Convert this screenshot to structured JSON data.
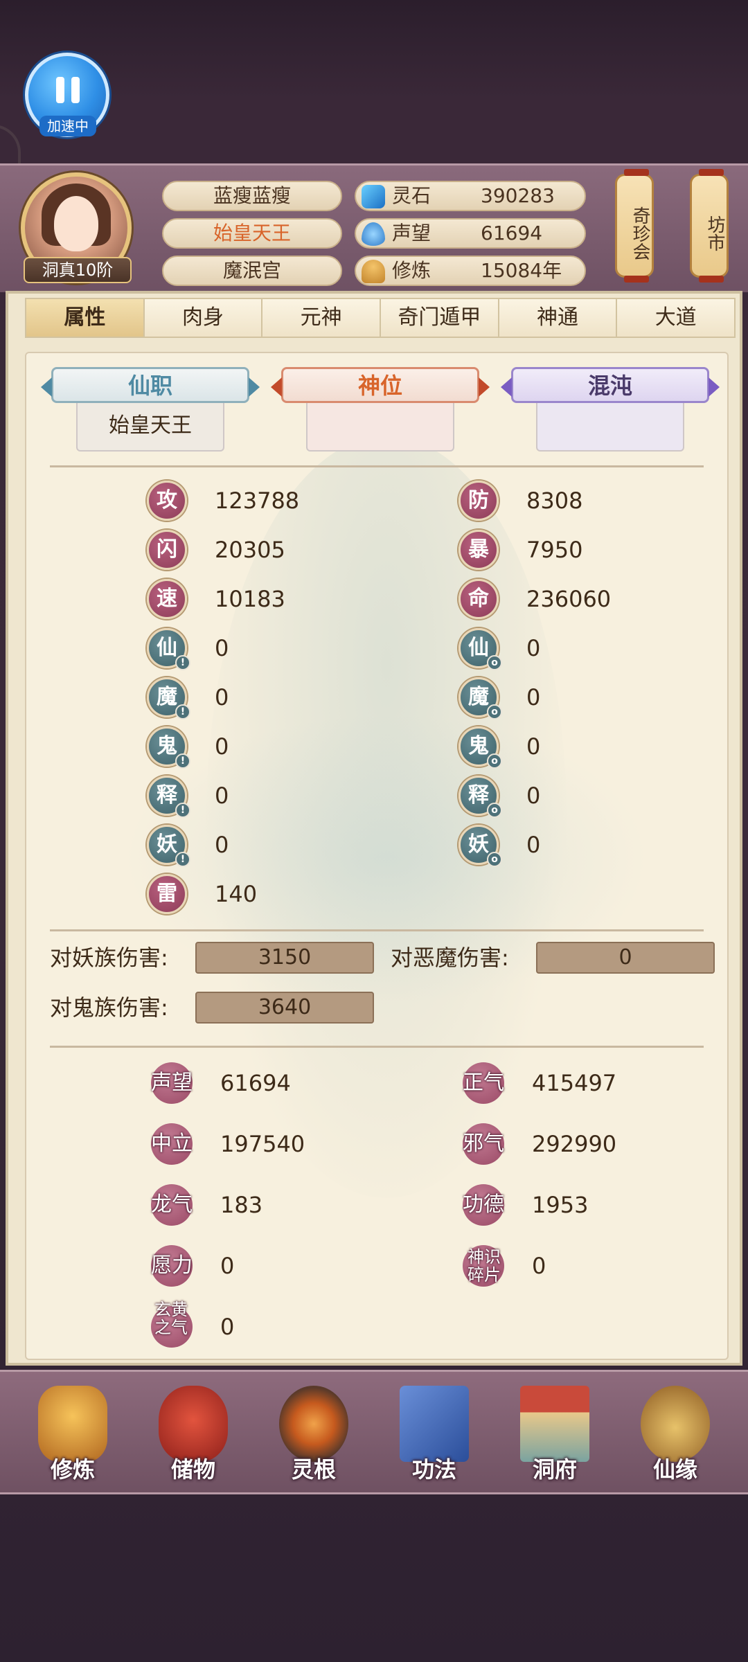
{
  "speed_button": {
    "label": "加速中"
  },
  "header": {
    "level": "洞真10阶",
    "names": [
      "蓝瘦蓝瘦",
      "始皇天王",
      "魔泯宫"
    ],
    "resources": [
      {
        "label": "灵石",
        "value": "390283",
        "icon": "spirit-stone-icon"
      },
      {
        "label": "声望",
        "value": "61694",
        "icon": "reputation-icon"
      },
      {
        "label": "修炼",
        "value": "15084年",
        "icon": "meditation-icon"
      }
    ],
    "lanterns": [
      "奇珍会",
      "坊市"
    ]
  },
  "tabs": [
    "属性",
    "肉身",
    "元神",
    "奇门遁甲",
    "神通",
    "大道"
  ],
  "active_tab": "属性",
  "positions": {
    "xianzhi": {
      "title": "仙职",
      "value": "始皇天王"
    },
    "shenwei": {
      "title": "神位",
      "value": ""
    },
    "hundun": {
      "title": "混沌",
      "value": ""
    }
  },
  "attributes_left": [
    {
      "glyph": "攻",
      "value": "123788"
    },
    {
      "glyph": "闪",
      "value": "20305"
    },
    {
      "glyph": "速",
      "value": "10183"
    },
    {
      "glyph": "仙",
      "value": "0"
    },
    {
      "glyph": "魔",
      "value": "0"
    },
    {
      "glyph": "鬼",
      "value": "0"
    },
    {
      "glyph": "释",
      "value": "0"
    },
    {
      "glyph": "妖",
      "value": "0"
    },
    {
      "glyph": "雷",
      "value": "140"
    }
  ],
  "attributes_right": [
    {
      "glyph": "防",
      "value": "8308"
    },
    {
      "glyph": "暴",
      "value": "7950"
    },
    {
      "glyph": "命",
      "value": "236060"
    },
    {
      "glyph": "仙",
      "value": "0"
    },
    {
      "glyph": "魔",
      "value": "0"
    },
    {
      "glyph": "鬼",
      "value": "0"
    },
    {
      "glyph": "释",
      "value": "0"
    },
    {
      "glyph": "妖",
      "value": "0"
    }
  ],
  "damage": {
    "yao": {
      "label": "对妖族伤害:",
      "value": "3150"
    },
    "emo": {
      "label": "对恶魔伤害:",
      "value": "0"
    },
    "gui": {
      "label": "对鬼族伤害:",
      "value": "3640"
    }
  },
  "stats": {
    "shengwang": {
      "label": "声望",
      "value": "61694"
    },
    "zhengqi": {
      "label": "正气",
      "value": "415497"
    },
    "zhongli": {
      "label": "中立",
      "value": "197540"
    },
    "xieqi": {
      "label": "邪气",
      "value": "292990"
    },
    "longqi": {
      "label": "龙气",
      "value": "183"
    },
    "gongde": {
      "label": "功德",
      "value": "1953"
    },
    "yuanli": {
      "label": "愿力",
      "value": "0"
    },
    "shenshi": {
      "label": "神识碎片",
      "value": "0"
    },
    "xuanhuang": {
      "label": "玄黄之气",
      "value": "0"
    }
  },
  "bottom_nav": [
    "修炼",
    "储物",
    "灵根",
    "功法",
    "洞府",
    "仙缘"
  ]
}
